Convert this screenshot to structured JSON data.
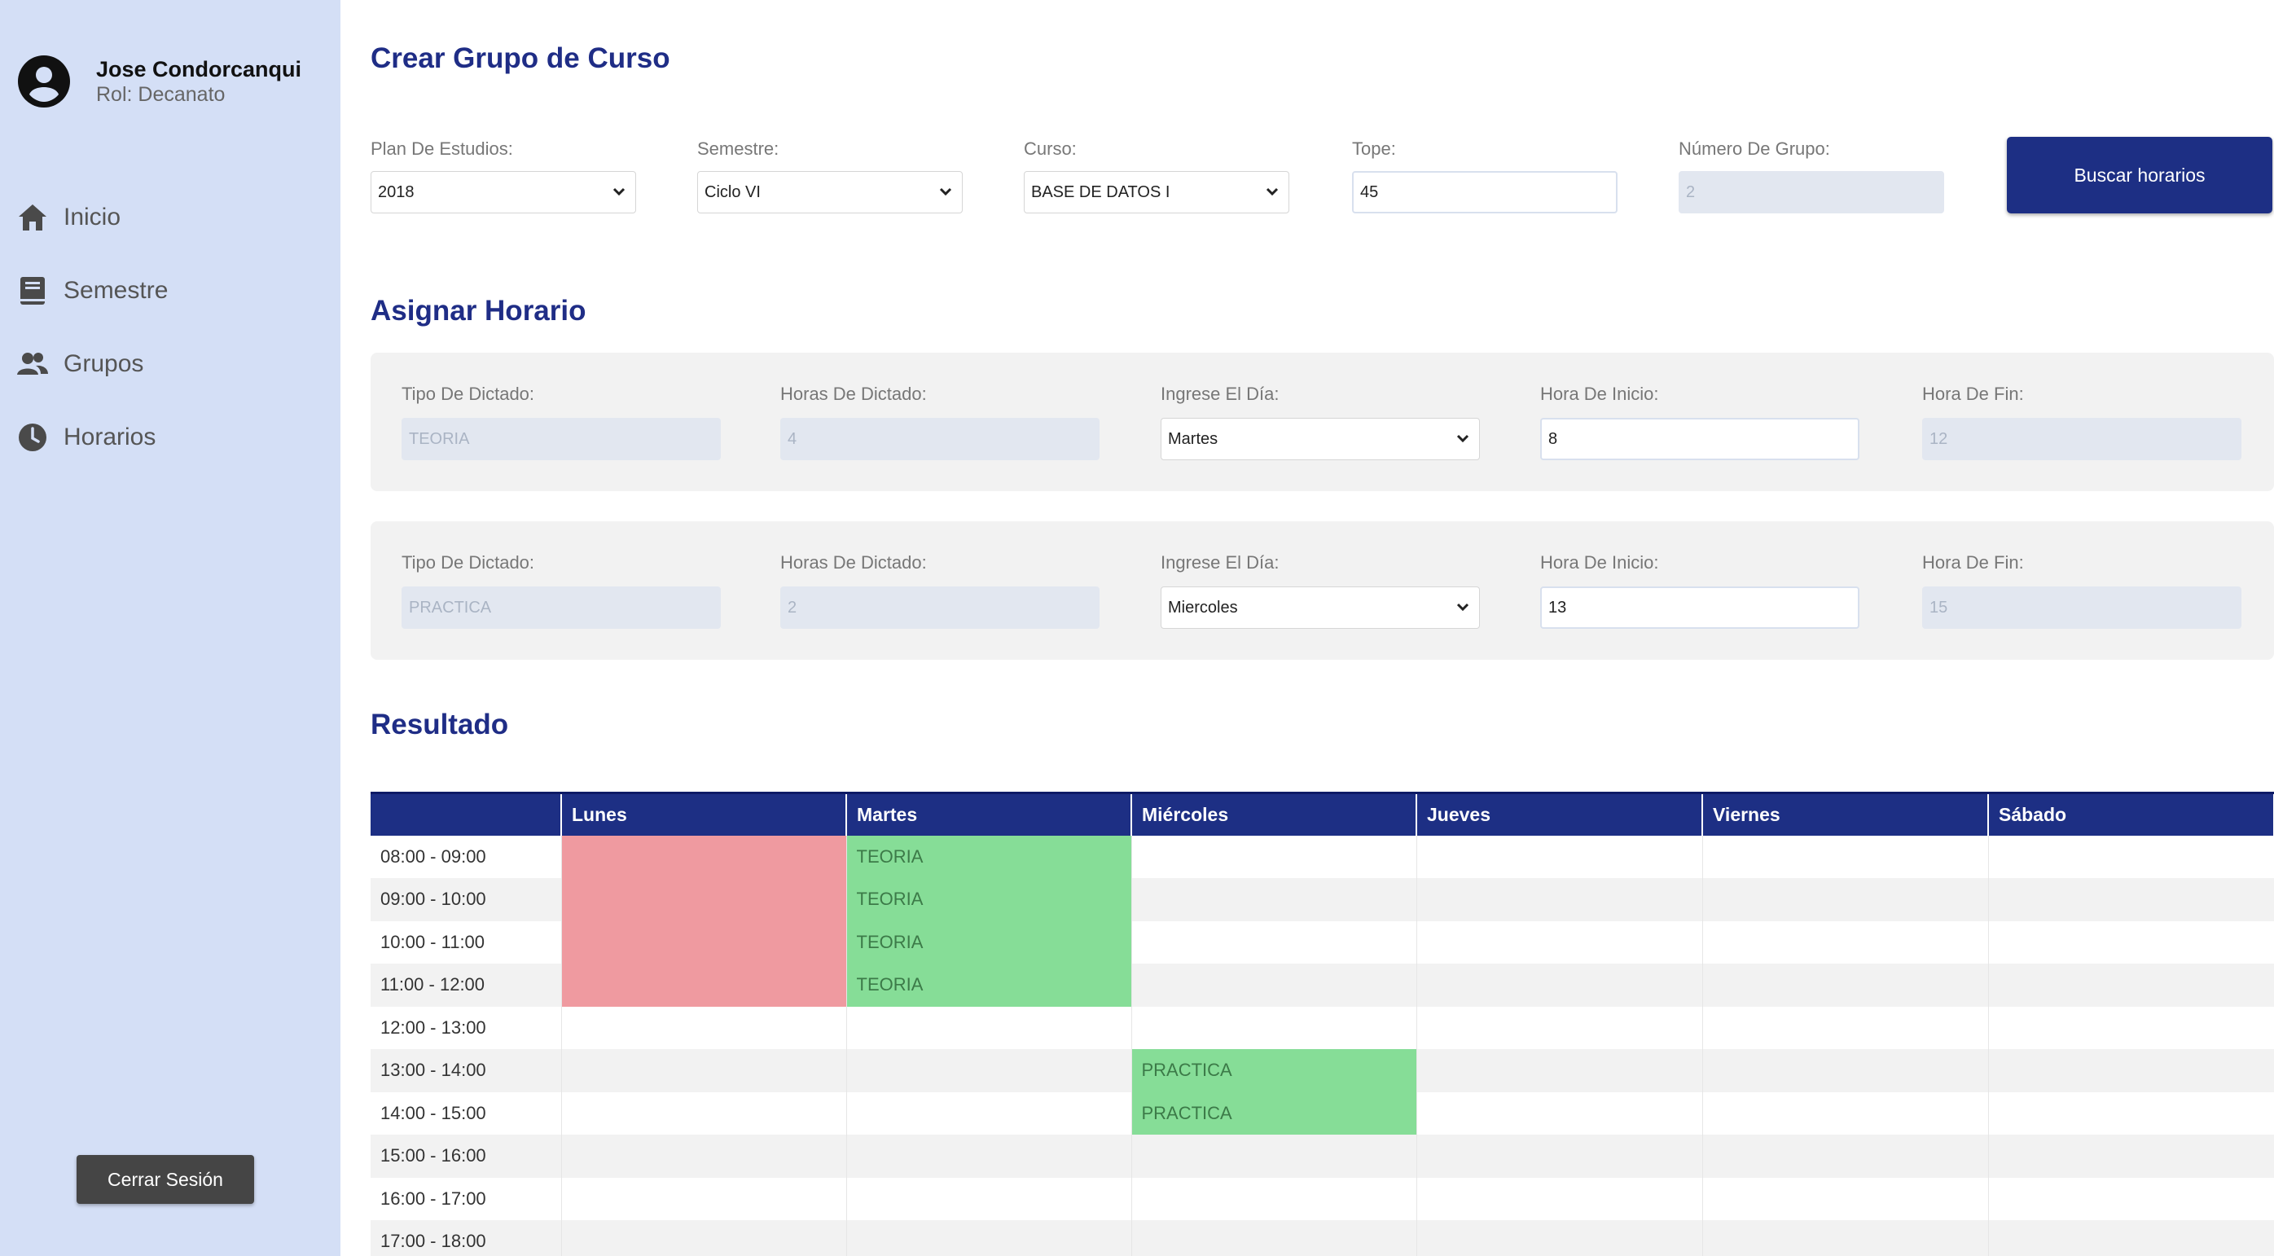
{
  "sidebar": {
    "user_name": "Jose Condorcanqui",
    "user_role": "Rol: Decanato",
    "items": [
      {
        "label": "Inicio",
        "icon": "home-icon"
      },
      {
        "label": "Semestre",
        "icon": "book-icon"
      },
      {
        "label": "Grupos",
        "icon": "users-icon"
      },
      {
        "label": "Horarios",
        "icon": "clock-icon"
      }
    ],
    "logout_label": "Cerrar Sesión"
  },
  "crear": {
    "title": "Crear Grupo de Curso",
    "plan_label": "Plan De Estudios:",
    "plan_value": "2018",
    "semestre_label": "Semestre:",
    "semestre_value": "Ciclo VI",
    "curso_label": "Curso:",
    "curso_value": "BASE DE DATOS I",
    "tope_label": "Tope:",
    "tope_value": "45",
    "grupo_label": "Número De Grupo:",
    "grupo_value": "2",
    "search_label": "Buscar horarios"
  },
  "asignar": {
    "title": "Asignar Horario",
    "rows": [
      {
        "tipo_label": "Tipo De Dictado:",
        "tipo": "TEORIA",
        "horas_label": "Horas De Dictado:",
        "horas": "4",
        "dia_label": "Ingrese El Día:",
        "dia": "Martes",
        "inicio_label": "Hora De Inicio:",
        "inicio": "8",
        "fin_label": "Hora De Fin:",
        "fin": "12"
      },
      {
        "tipo_label": "Tipo De Dictado:",
        "tipo": "PRACTICA",
        "horas_label": "Horas De Dictado:",
        "horas": "2",
        "dia_label": "Ingrese El Día:",
        "dia": "Miercoles",
        "inicio_label": "Hora De Inicio:",
        "inicio": "13",
        "fin_label": "Hora De Fin:",
        "fin": "15"
      }
    ]
  },
  "resultado": {
    "title": "Resultado",
    "days": [
      "Lunes",
      "Martes",
      "Miércoles",
      "Jueves",
      "Viernes",
      "Sábado"
    ],
    "rows": [
      {
        "time": "08:00 - 09:00",
        "cells": [
          "",
          "TEORIA",
          "",
          "",
          "",
          ""
        ],
        "busy": [
          true,
          false,
          false,
          false,
          false,
          false
        ],
        "assigned": [
          false,
          true,
          false,
          false,
          false,
          false
        ]
      },
      {
        "time": "09:00 - 10:00",
        "cells": [
          "",
          "TEORIA",
          "",
          "",
          "",
          ""
        ],
        "busy": [
          true,
          false,
          false,
          false,
          false,
          false
        ],
        "assigned": [
          false,
          true,
          false,
          false,
          false,
          false
        ]
      },
      {
        "time": "10:00 - 11:00",
        "cells": [
          "",
          "TEORIA",
          "",
          "",
          "",
          ""
        ],
        "busy": [
          true,
          false,
          false,
          false,
          false,
          false
        ],
        "assigned": [
          false,
          true,
          false,
          false,
          false,
          false
        ]
      },
      {
        "time": "11:00 - 12:00",
        "cells": [
          "",
          "TEORIA",
          "",
          "",
          "",
          ""
        ],
        "busy": [
          true,
          false,
          false,
          false,
          false,
          false
        ],
        "assigned": [
          false,
          true,
          false,
          false,
          false,
          false
        ]
      },
      {
        "time": "12:00 - 13:00",
        "cells": [
          "",
          "",
          "",
          "",
          "",
          ""
        ],
        "busy": [
          false,
          false,
          false,
          false,
          false,
          false
        ],
        "assigned": [
          false,
          false,
          false,
          false,
          false,
          false
        ]
      },
      {
        "time": "13:00 - 14:00",
        "cells": [
          "",
          "",
          "PRACTICA",
          "",
          "",
          ""
        ],
        "busy": [
          false,
          false,
          false,
          false,
          false,
          false
        ],
        "assigned": [
          false,
          false,
          true,
          false,
          false,
          false
        ]
      },
      {
        "time": "14:00 - 15:00",
        "cells": [
          "",
          "",
          "PRACTICA",
          "",
          "",
          ""
        ],
        "busy": [
          false,
          false,
          false,
          false,
          false,
          false
        ],
        "assigned": [
          false,
          false,
          true,
          false,
          false,
          false
        ]
      },
      {
        "time": "15:00 - 16:00",
        "cells": [
          "",
          "",
          "",
          "",
          "",
          ""
        ],
        "busy": [
          false,
          false,
          false,
          false,
          false,
          false
        ],
        "assigned": [
          false,
          false,
          false,
          false,
          false,
          false
        ]
      },
      {
        "time": "16:00 - 17:00",
        "cells": [
          "",
          "",
          "",
          "",
          "",
          ""
        ],
        "busy": [
          false,
          false,
          false,
          false,
          false,
          false
        ],
        "assigned": [
          false,
          false,
          false,
          false,
          false,
          false
        ]
      },
      {
        "time": "17:00 - 18:00",
        "cells": [
          "",
          "",
          "",
          "",
          "",
          ""
        ],
        "busy": [
          false,
          false,
          false,
          false,
          false,
          false
        ],
        "assigned": [
          false,
          false,
          false,
          false,
          false,
          false
        ]
      }
    ]
  },
  "colors": {
    "sidebar_bg": "#d4dff6",
    "primary": "#1d2f84",
    "busy": "#ef9aa0",
    "assigned": "#86dd97"
  }
}
